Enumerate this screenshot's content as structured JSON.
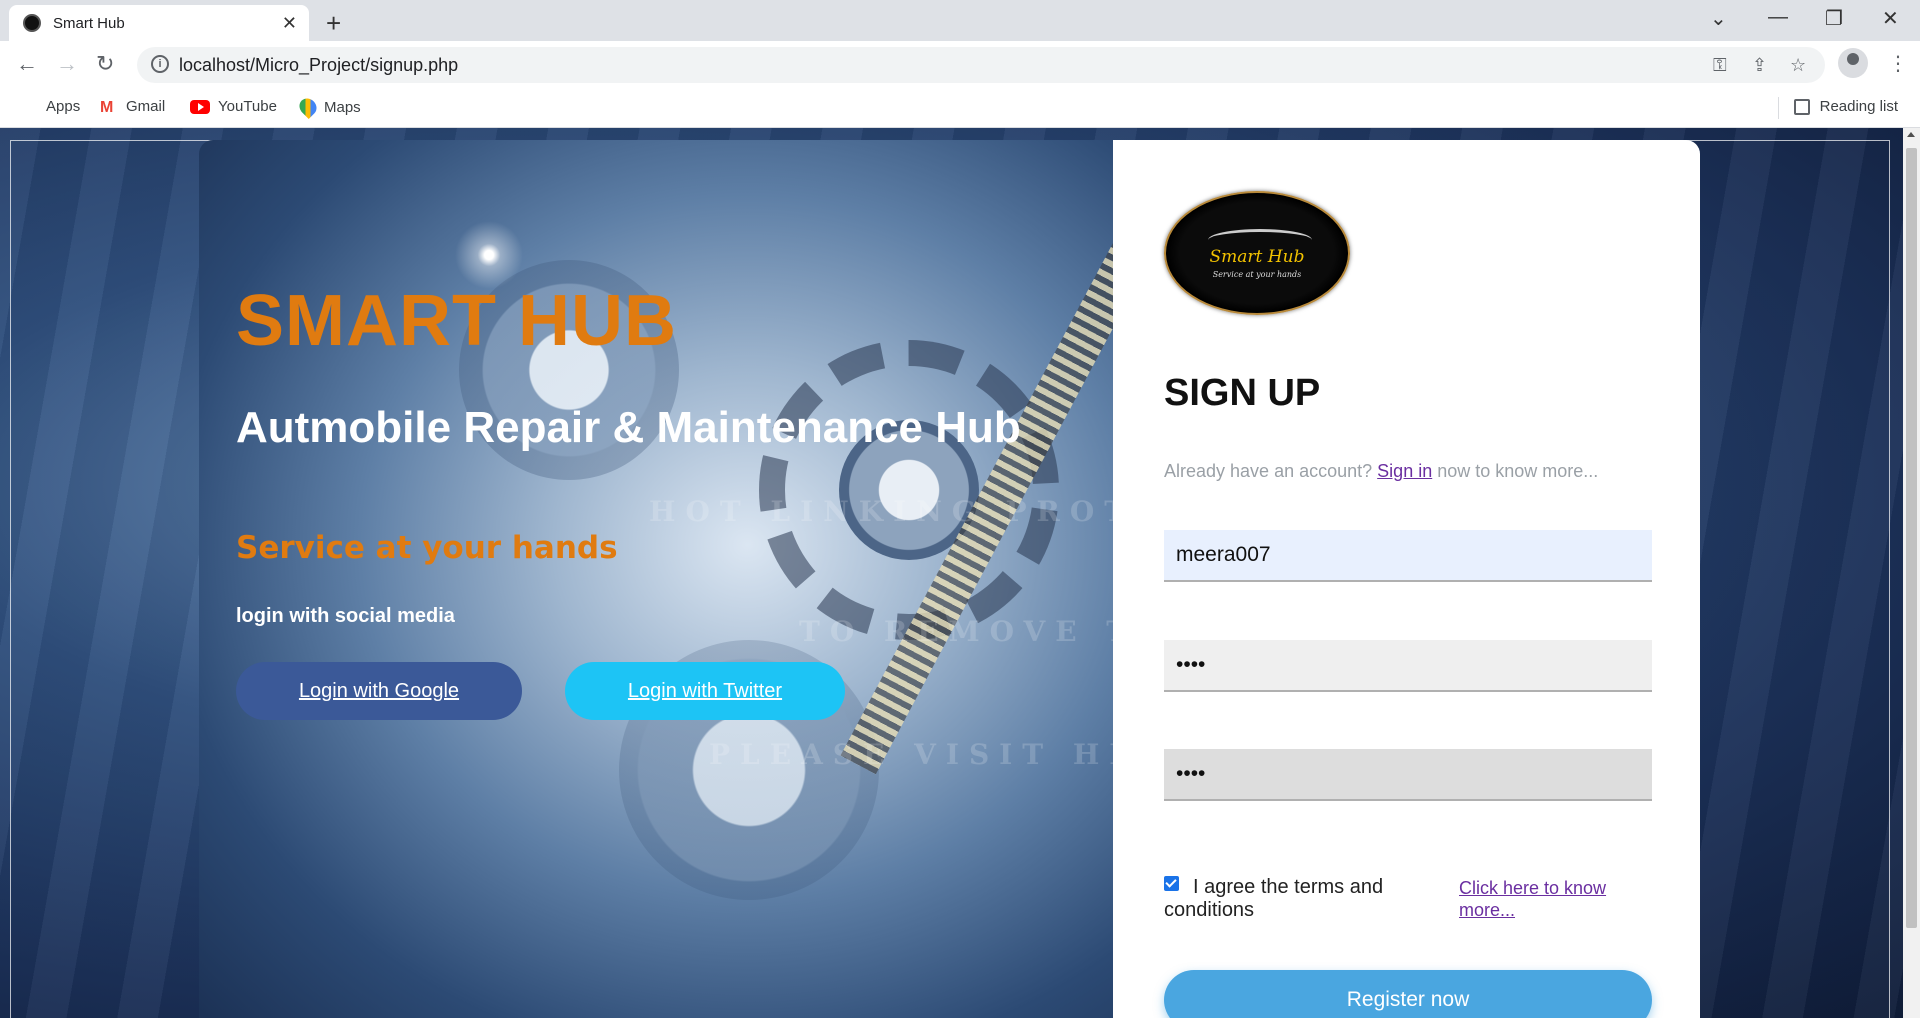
{
  "browser": {
    "tab_title": "Smart Hub",
    "url": "localhost/Micro_Project/signup.php",
    "bookmarks": [
      {
        "label": "Apps",
        "icon": "apps-grid-icon"
      },
      {
        "label": "Gmail",
        "icon": "gmail-icon"
      },
      {
        "label": "YouTube",
        "icon": "youtube-icon"
      },
      {
        "label": "Maps",
        "icon": "maps-icon"
      }
    ],
    "reading_list": "Reading list"
  },
  "hero": {
    "title": "SMART HUB",
    "subtitle": "Autmobile Repair & Maintenance Hub",
    "tagline": "Service at your hands",
    "social_label": "login with social media",
    "google_btn": "Login with Google",
    "twitter_btn": "Login with Twitter",
    "watermarks": [
      "HOT LINKING PROTECT",
      "TO REMOVE TH",
      "PLEASE VISIT HDWA"
    ]
  },
  "form": {
    "logo_text": "Smart Hub",
    "logo_tagline": "Service at your hands",
    "title": "SIGN UP",
    "already_prefix": "Already have an account?",
    "signin_link": "Sign in",
    "already_suffix": "now to know more...",
    "username_value": "meera007",
    "password_value": "••••",
    "confirm_value": "••••",
    "terms_text": "I agree the terms and conditions",
    "terms_checked": true,
    "know_more_link": "Click here to know more...",
    "register_btn": "Register now"
  },
  "colors": {
    "brand_orange": "#e07b10",
    "google_btn": "#3b5998",
    "twitter_btn": "#1dc4f5",
    "register_btn": "#4aa6e0",
    "link_purple": "#6a2ea0"
  }
}
